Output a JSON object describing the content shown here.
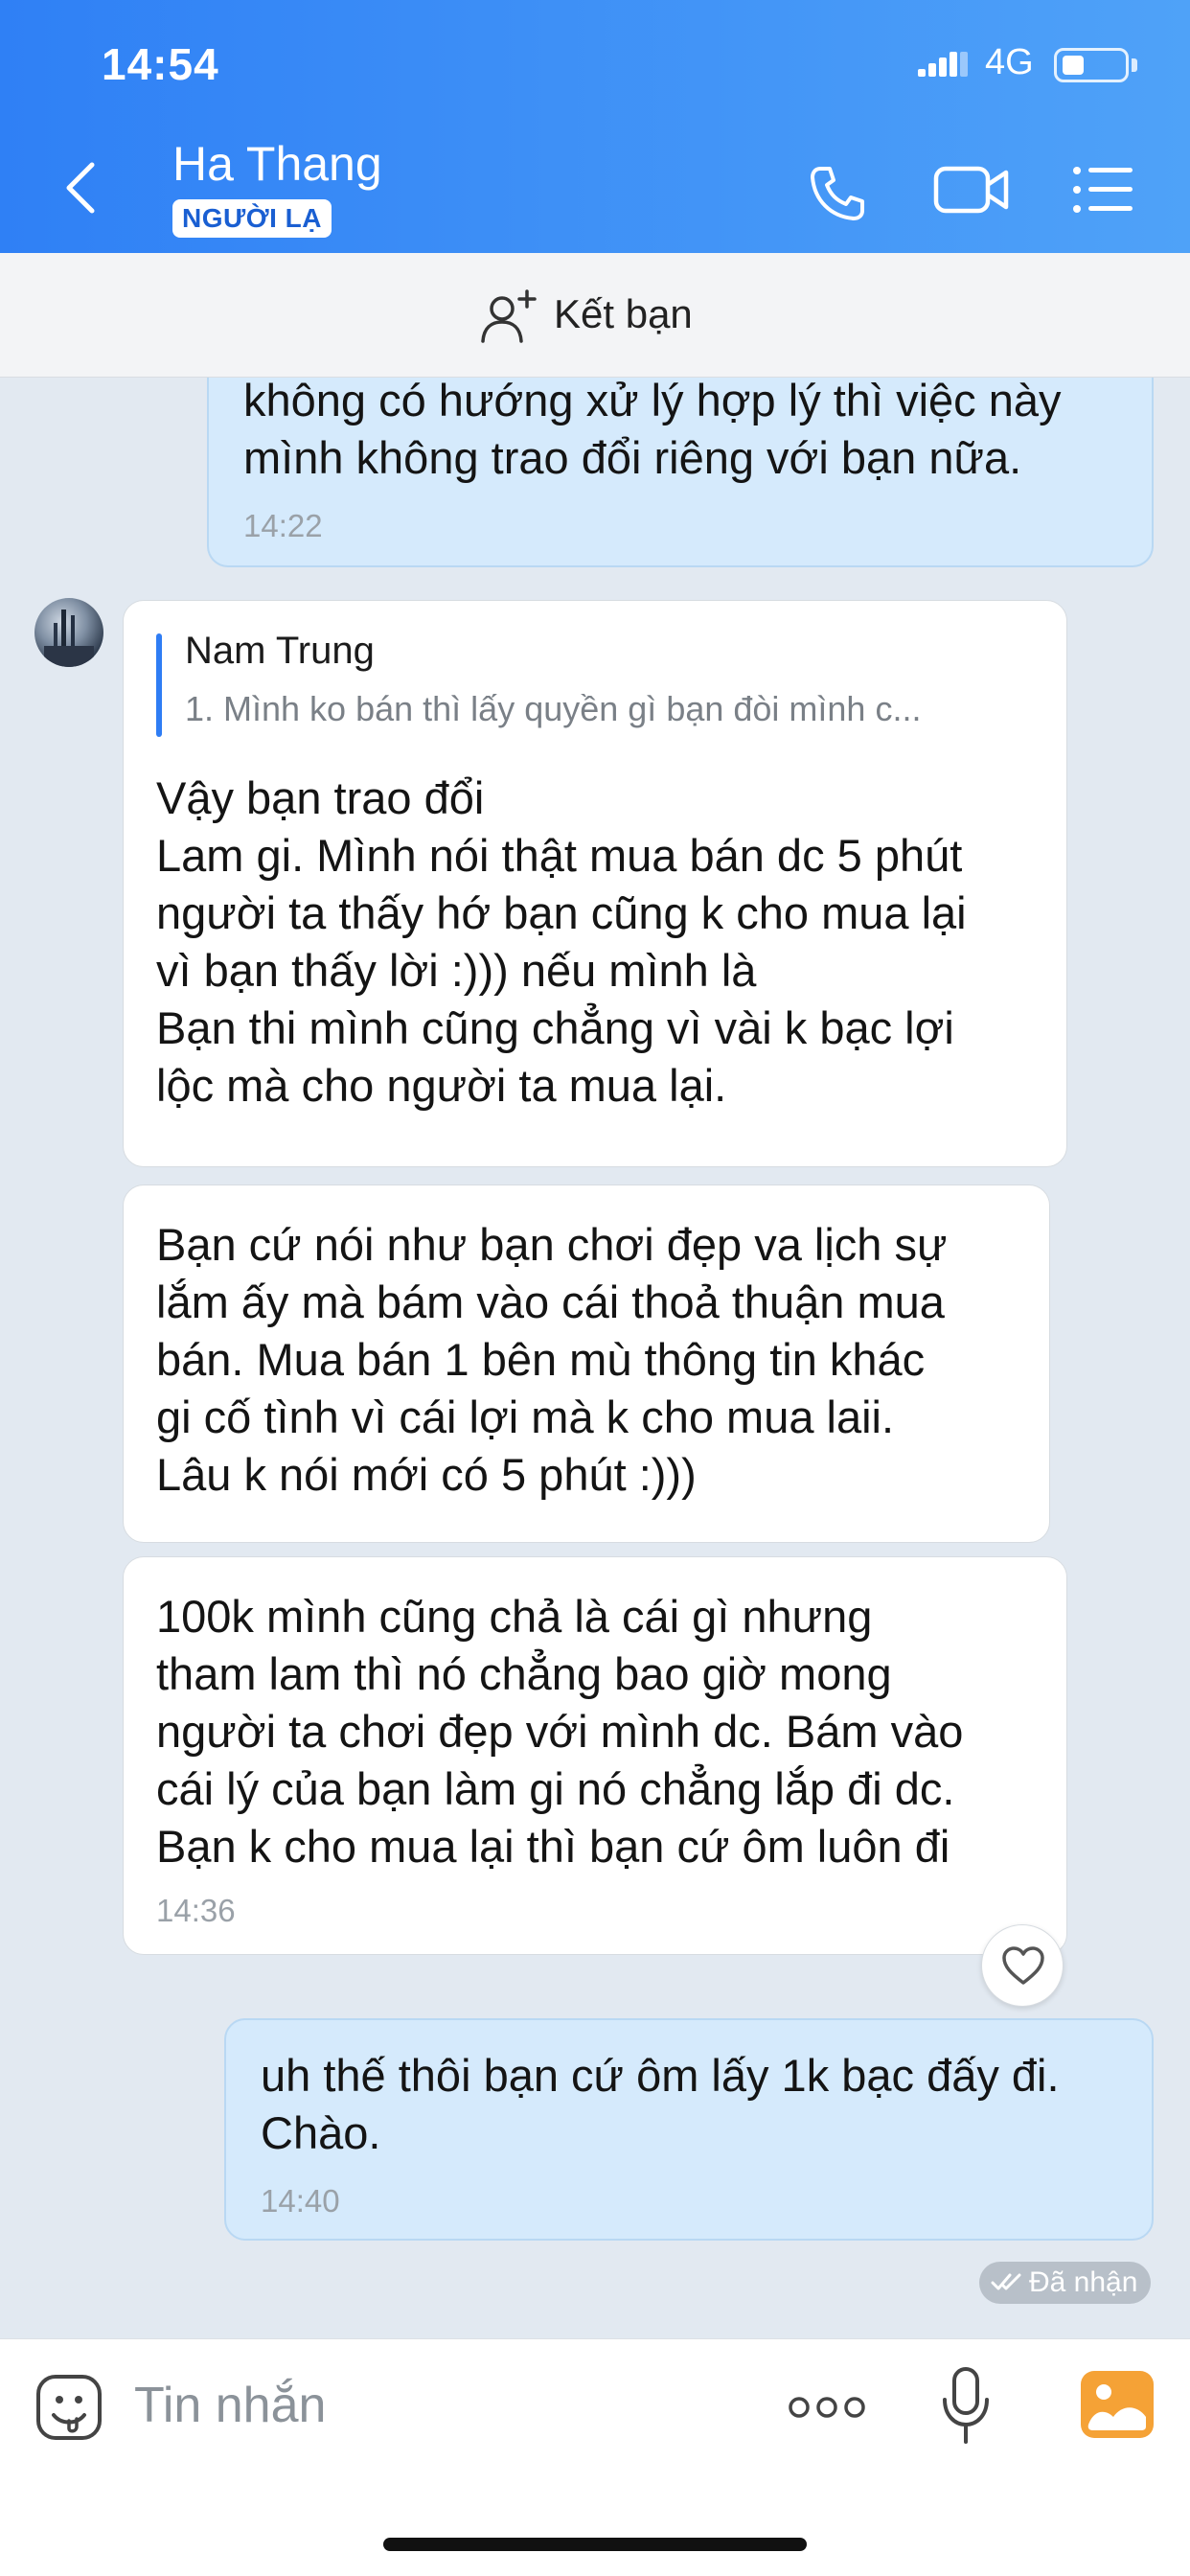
{
  "status_bar": {
    "time": "14:54",
    "network": "4G",
    "battery_level": 0.3
  },
  "header": {
    "contact_name": "Ha Thang",
    "badge": "NGƯỜI LẠ",
    "icons": [
      "back-arrow-icon",
      "phone-icon",
      "video-call-icon",
      "list-menu-icon"
    ]
  },
  "add_friend": {
    "label": "Kết bạn",
    "icon": "add-friend-icon"
  },
  "messages": [
    {
      "direction": "out",
      "text": "không có hướng xử lý hợp lý thì việc này\nmình không trao đổi riêng với bạn nữa.",
      "time": "14:22"
    },
    {
      "direction": "in",
      "quote": {
        "name": "Nam Trung",
        "text": "1. Mình ko bán thì lấy quyền gì bạn đòi mình c..."
      },
      "text": "Vậy bạn trao đổi\nLam gi. Mình nói thật mua bán dc 5 phút\nngười ta thấy hớ bạn cũng k cho mua lại\nvì bạn thấy lời :))) nếu mình là\nBạn thi mình cũng chẳng vì vài k bạc lợi\nlộc mà cho người ta mua lại."
    },
    {
      "direction": "in",
      "text": "Bạn cứ nói như bạn chơi đẹp va lịch sự\nlắm ấy mà bám vào cái thoả thuận mua\nbán. Mua bán 1 bên mù thông tin khác\ngi cố tình vì cái lợi mà k cho mua laii.\nLâu k nói mới có 5 phút :)))"
    },
    {
      "direction": "in",
      "text": "100k mình cũng chả là cái gì nhưng\ntham lam thì nó chẳng bao giờ mong\nngười ta chơi đẹp với mình dc. Bám vào\ncái lý của bạn làm gi nó chẳng lắp đi dc.\nBạn k cho mua lại thì bạn cứ ôm luôn đi",
      "time": "14:36"
    },
    {
      "direction": "out",
      "text": "uh thế thôi bạn cứ ôm lấy 1k bạc đấy đi.\nChào.",
      "time": "14:40",
      "status": "Đã nhận"
    }
  ],
  "composer": {
    "placeholder": "Tin nhắn"
  },
  "colors": {
    "header_start": "#2f80f5",
    "header_end": "#4fa2f8",
    "bubble_out": "#d5eafc",
    "bubble_in": "#ffffff",
    "chat_bg": "#e2e9f1",
    "accent": "#2f7df4",
    "gallery": "#f5a236"
  }
}
